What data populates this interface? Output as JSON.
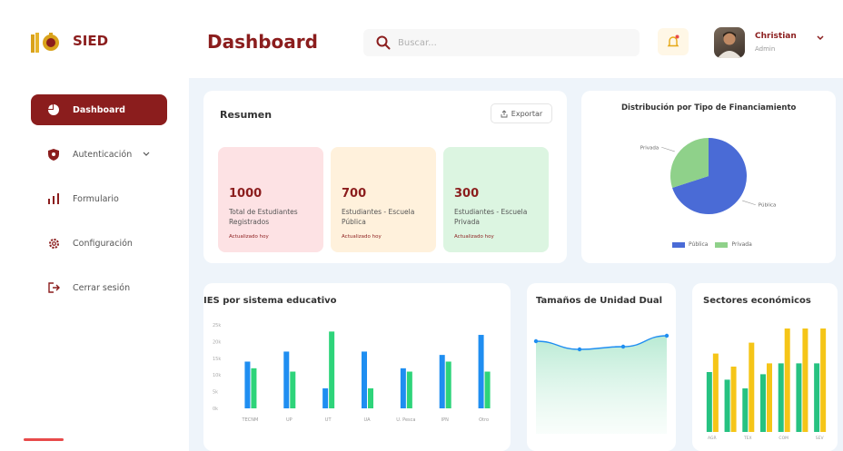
{
  "header": {
    "logo_text": "SIED",
    "page_title": "Dashboard",
    "search_placeholder": "Buscar...",
    "user_name": "Christian",
    "user_role": "Admin"
  },
  "sidebar": {
    "items": [
      {
        "label": "Dashboard",
        "icon": "pie-chart-icon",
        "active": true
      },
      {
        "label": "Autenticación",
        "icon": "shield-icon",
        "active": false
      },
      {
        "label": "Formulario",
        "icon": "bar-chart-icon",
        "active": false
      },
      {
        "label": "Configuración",
        "icon": "gear-icon",
        "active": false
      },
      {
        "label": "Cerrar sesión",
        "icon": "logout-icon",
        "active": false
      }
    ]
  },
  "resumen": {
    "title": "Resumen",
    "export_label": "Exportar",
    "stats": [
      {
        "value": "1000",
        "label": "Total de Estudiantes Registrados",
        "updated": "Actualizado hoy",
        "bg": "#fde2e4",
        "color": "#8b1d1d"
      },
      {
        "value": "700",
        "label": "Estudiantes - Escuela Pública",
        "updated": "Actualizado hoy",
        "bg": "#fff1dc",
        "color": "#8b1d1d"
      },
      {
        "value": "300",
        "label": "Estudiantes - Escuela Privada",
        "updated": "Actualizado hoy",
        "bg": "#dcf5e1",
        "color": "#8b1d1d"
      }
    ]
  },
  "colors": {
    "brand": "#8b1d1d",
    "blue": "#1f8ef1",
    "green": "#2ed47a",
    "yellow": "#f5c518",
    "teal": "#26c281",
    "pie_blue": "#4a6bd6",
    "pie_green": "#8fd18a"
  },
  "charts": [
    {
      "type": "pie",
      "title": "Distribución por Tipo de Financiamiento",
      "slices": [
        {
          "name": "Pública",
          "value": 70
        },
        {
          "name": "Privada",
          "value": 30
        }
      ],
      "legend": [
        "Pública",
        "Privada"
      ]
    },
    {
      "type": "bar",
      "title": "IES por sistema educativo",
      "categories": [
        "TECNM",
        "UP",
        "UT",
        "UA",
        "U. Pesca",
        "IPN",
        "Otro"
      ],
      "series": [
        {
          "values": [
            14,
            17,
            6,
            17,
            12,
            16,
            22
          ]
        },
        {
          "values": [
            12,
            11,
            23,
            6,
            11,
            14,
            11
          ]
        }
      ],
      "ylim": [
        0,
        25
      ],
      "yticks": [
        "25k",
        "20k",
        "15k",
        "10k",
        "5k",
        "0k"
      ]
    },
    {
      "type": "line",
      "title": "Tamaños de Unidad Dual",
      "values": [
        70,
        55,
        60,
        80
      ]
    },
    {
      "type": "bar",
      "title": "Sectores económicos",
      "categories": [
        "AGR",
        "",
        "TEX",
        "",
        "COM",
        "",
        "SEV"
      ],
      "series": [
        {
          "values": [
            55,
            48,
            40,
            53,
            63,
            63,
            63
          ]
        },
        {
          "values": [
            72,
            60,
            82,
            63,
            95,
            95,
            95
          ]
        }
      ]
    }
  ]
}
